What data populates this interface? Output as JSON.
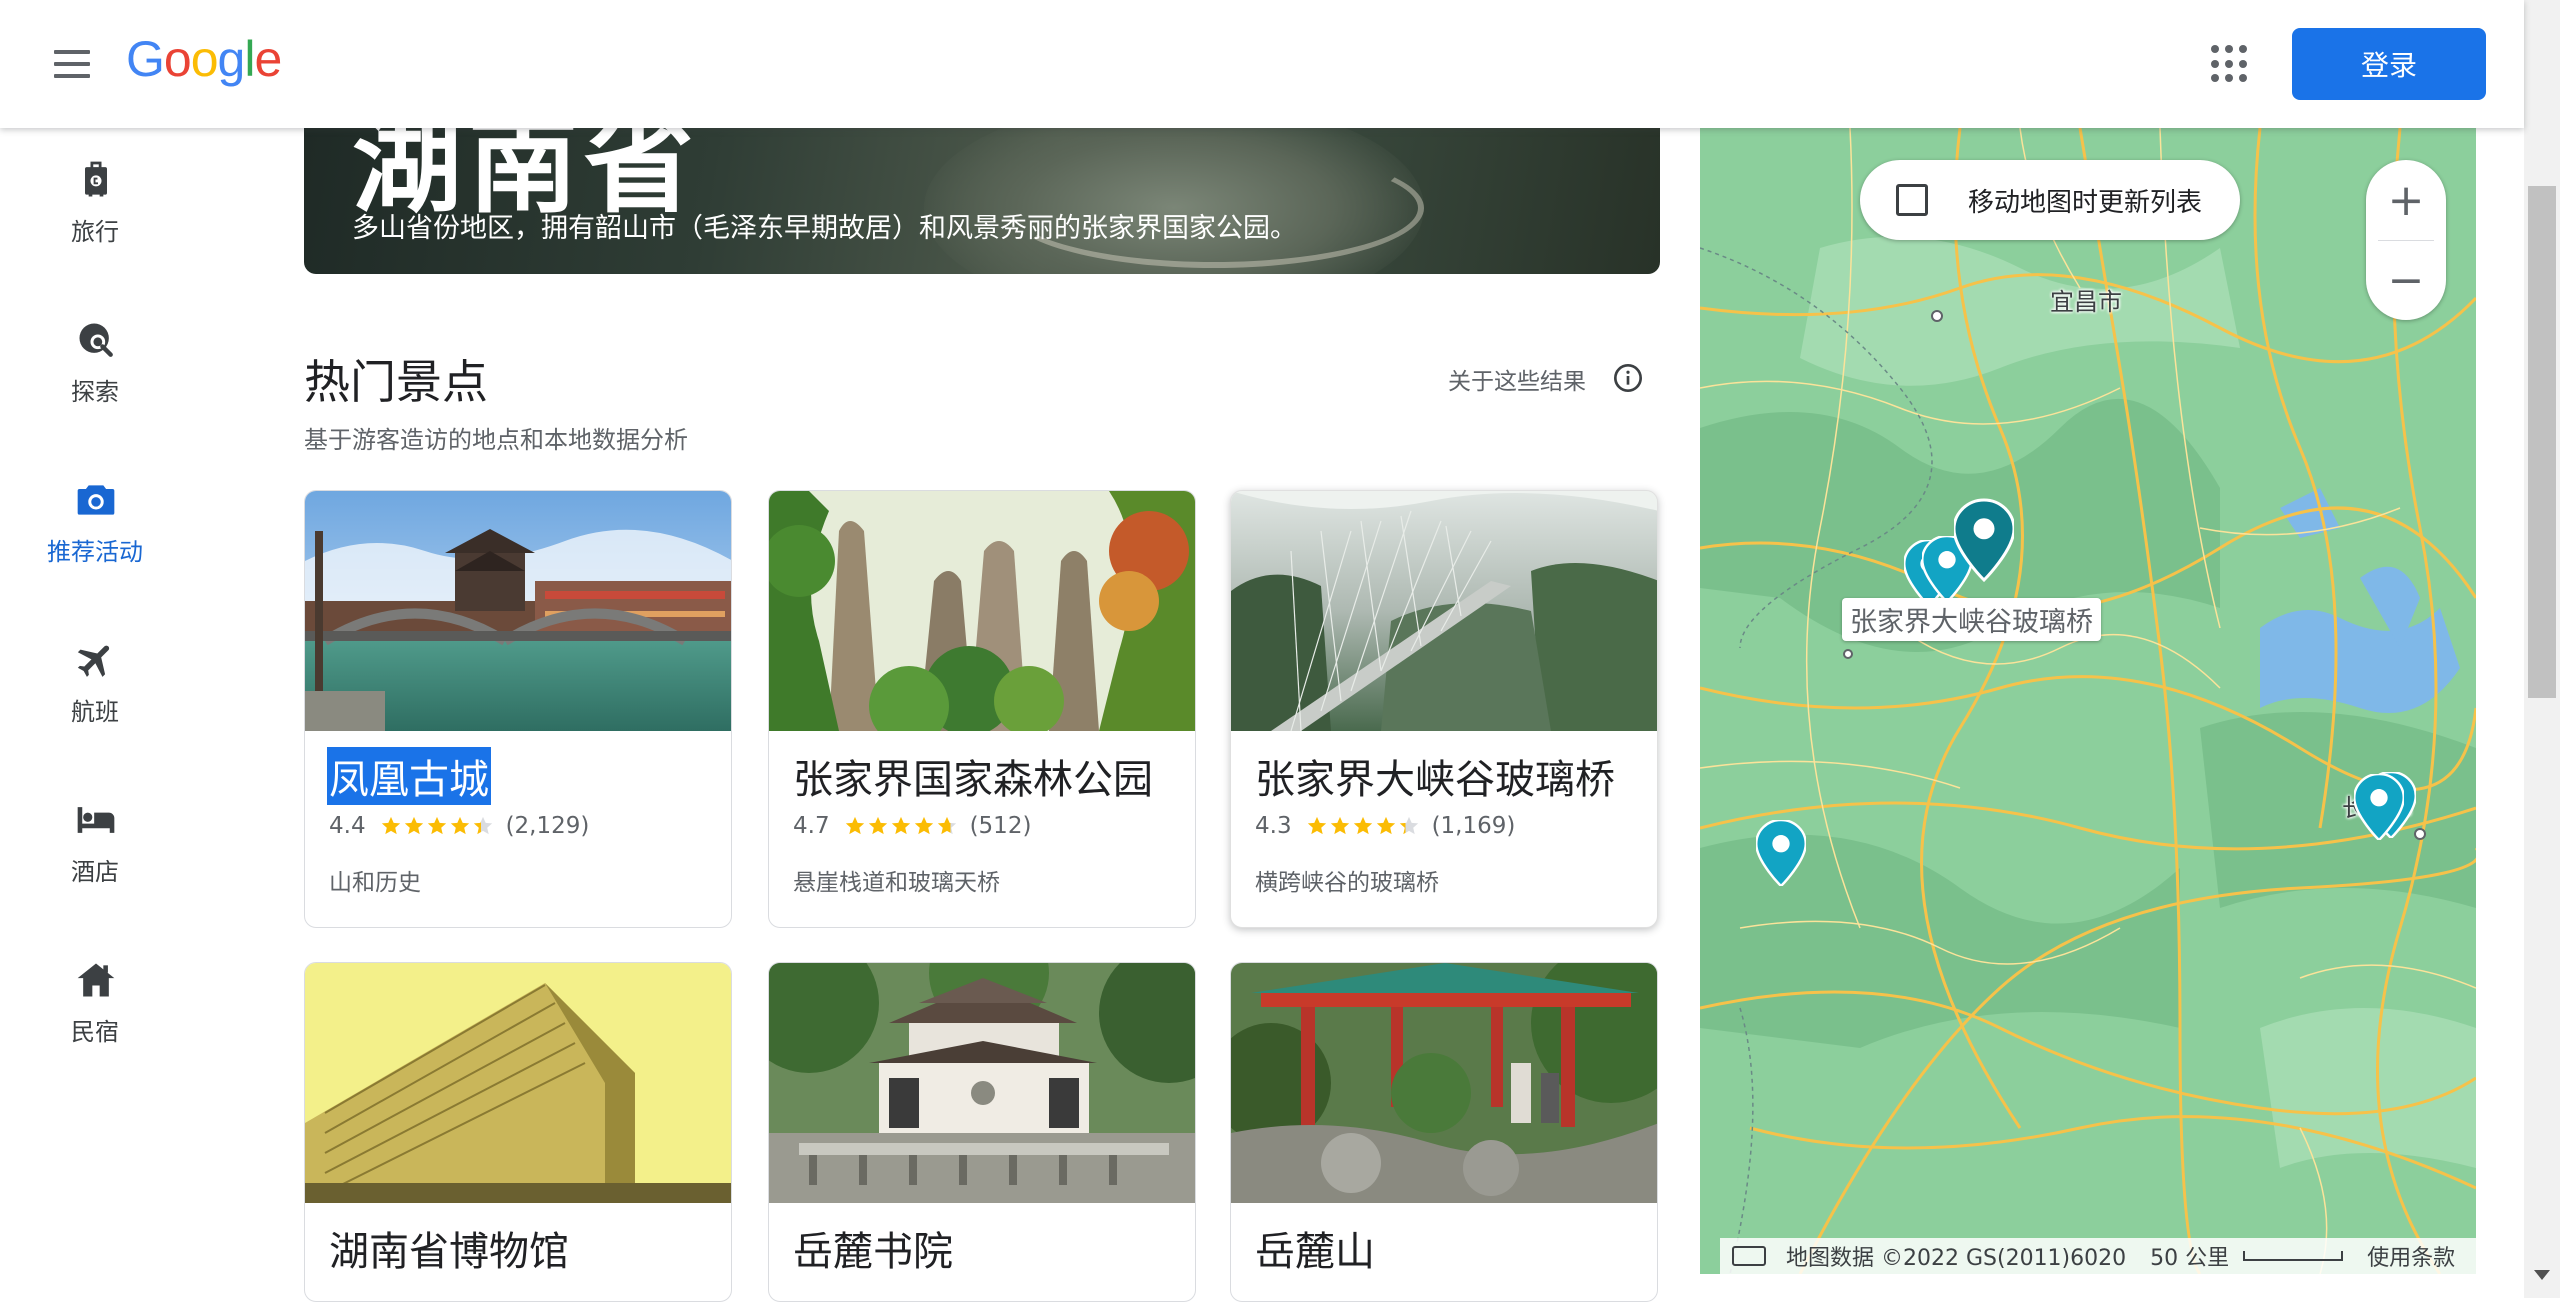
{
  "header": {
    "logo_letters": [
      "G",
      "o",
      "o",
      "g",
      "l",
      "e"
    ],
    "logo_colors": [
      "#4285F4",
      "#EA4335",
      "#FBBC05",
      "#4285F4",
      "#34A853",
      "#EA4335"
    ],
    "login_label": "登录",
    "menu_icon": "hamburger-menu-icon",
    "apps_icon": "apps-grid-icon"
  },
  "nav": {
    "items": [
      {
        "label": "旅行",
        "icon": "luggage-icon",
        "active": false
      },
      {
        "label": "探索",
        "icon": "explore-icon",
        "active": false
      },
      {
        "label": "推荐活动",
        "icon": "camera-icon",
        "active": true
      },
      {
        "label": "航班",
        "icon": "flight-icon",
        "active": false
      },
      {
        "label": "酒店",
        "icon": "hotel-bed-icon",
        "active": false
      },
      {
        "label": "民宿",
        "icon": "home-icon",
        "active": false
      }
    ],
    "active_color": "#1967d2"
  },
  "hero": {
    "title": "湖南省",
    "description": "多山省份地区，拥有韶山市（毛泽东早期故居）和风景秀丽的张家界国家公园。"
  },
  "section": {
    "title": "热门景点",
    "subtitle": "基于游客造访的地点和本地数据分析",
    "about_label": "关于这些结果"
  },
  "attractions": [
    {
      "name": "凤凰古城",
      "rating": "4.4",
      "stars": 4.4,
      "reviews": "(2,129)",
      "description": "山和历史"
    },
    {
      "name": "张家界国家森林公园",
      "rating": "4.7",
      "stars": 4.7,
      "reviews": "(512)",
      "description": "悬崖栈道和玻璃天桥"
    },
    {
      "name": "张家界大峡谷玻璃桥",
      "rating": "4.3",
      "stars": 4.3,
      "reviews": "(1,169)",
      "description": "横跨峡谷的玻璃桥"
    },
    {
      "name": "湖南省博物馆"
    },
    {
      "name": "岳麓书院"
    },
    {
      "name": "岳麓山"
    }
  ],
  "map": {
    "toggle_label": "移动地图时更新列表",
    "zoom_in": "+",
    "zoom_out": "−",
    "city_yichang": "宜昌市",
    "city_changsha": "长沙市",
    "pin_label": "张家界大峡谷玻璃桥",
    "attribution": "地图数据 ©2022 GS(2011)6020",
    "scale_label": "50 公里",
    "terms_label": "使用条款",
    "pin_color": "#12a4c4",
    "pin_selected_color": "#0f7c8c"
  },
  "colors": {
    "accent": "#1a73e8",
    "star": "#fbbc04",
    "star_empty": "#dadce0"
  }
}
